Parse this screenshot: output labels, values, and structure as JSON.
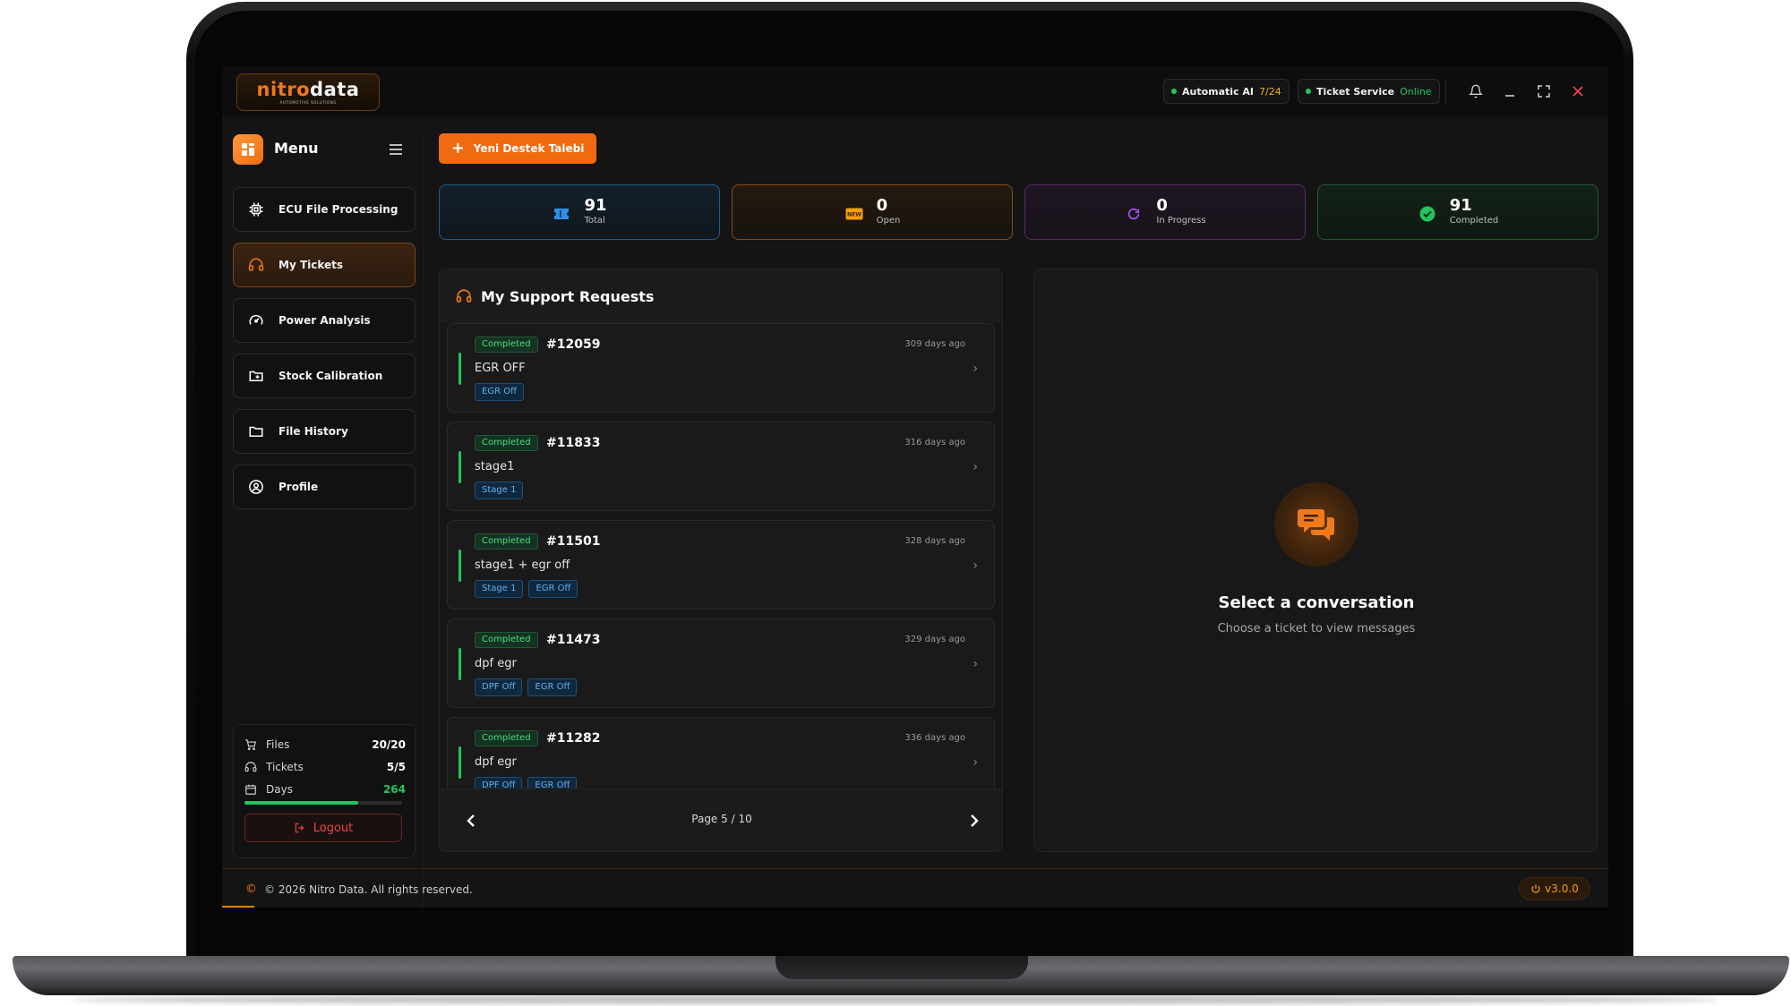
{
  "app": {
    "logo_nitro": "nitro",
    "logo_data": "data",
    "logo_tagline": "AUTOMOTIVE SOLUTIONS"
  },
  "topbar": {
    "ai_label": "Automatic AI",
    "ai_value": "7/24",
    "service_label": "Ticket Service",
    "service_value": "Online"
  },
  "sidebar": {
    "title": "Menu",
    "items": [
      {
        "label": "ECU File Processing",
        "icon": "chip-icon"
      },
      {
        "label": "My Tickets",
        "icon": "headset-icon",
        "active": true
      },
      {
        "label": "Power Analysis",
        "icon": "gauge-icon"
      },
      {
        "label": "Stock Calibration",
        "icon": "folder-plus-icon"
      },
      {
        "label": "File History",
        "icon": "folder-icon"
      },
      {
        "label": "Profile",
        "icon": "user-circle-icon"
      }
    ],
    "stats": {
      "files_label": "Files",
      "files_value": "20/20",
      "tickets_label": "Tickets",
      "tickets_value": "5/5",
      "days_label": "Days",
      "days_value": "264",
      "days_progress": 0.72
    },
    "logout_label": "Logout"
  },
  "main": {
    "new_ticket_label": "Yeni Destek Talebi",
    "stats": [
      {
        "value": "91",
        "label": "Total"
      },
      {
        "value": "0",
        "label": "Open"
      },
      {
        "value": "0",
        "label": "In Progress"
      },
      {
        "value": "91",
        "label": "Completed"
      }
    ],
    "requests_title": "My Support Requests",
    "tickets": [
      {
        "status": "Completed",
        "id": "#12059",
        "ago": "309 days ago",
        "title": "EGR OFF",
        "tags": [
          "EGR Off"
        ]
      },
      {
        "status": "Completed",
        "id": "#11833",
        "ago": "316 days ago",
        "title": "stage1",
        "tags": [
          "Stage 1"
        ]
      },
      {
        "status": "Completed",
        "id": "#11501",
        "ago": "328 days ago",
        "title": "stage1 + egr off",
        "tags": [
          "Stage 1",
          "EGR Off"
        ]
      },
      {
        "status": "Completed",
        "id": "#11473",
        "ago": "329 days ago",
        "title": "dpf egr",
        "tags": [
          "DPF Off",
          "EGR Off"
        ]
      },
      {
        "status": "Completed",
        "id": "#11282",
        "ago": "336 days ago",
        "title": "dpf egr",
        "tags": [
          "DPF Off",
          "EGR Off"
        ]
      }
    ],
    "pager": "Page 5 / 10",
    "conversation": {
      "title": "Select a conversation",
      "subtitle": "Choose a ticket to view messages"
    }
  },
  "footer": {
    "copyright": "© 2026 Nitro Data. All rights reserved.",
    "version": "v3.0.0"
  },
  "colors": {
    "accent": "#f06a10",
    "success": "#22c55e",
    "danger": "#ef4444",
    "info": "#1e90ff"
  }
}
